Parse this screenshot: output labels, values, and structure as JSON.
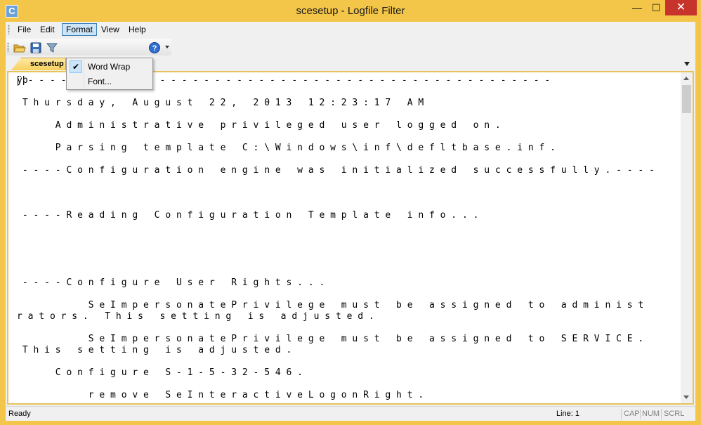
{
  "window": {
    "title": "scesetup - Logfile Filter",
    "icon_glyph": "C",
    "minimize_glyph": "—",
    "maximize_glyph": "☐",
    "close_glyph": "✕"
  },
  "menu": {
    "items": [
      "File",
      "Edit",
      "Format",
      "View",
      "Help"
    ],
    "active": "Format"
  },
  "format_menu": {
    "items": [
      {
        "label": "Word Wrap",
        "checked": true,
        "check_glyph": "✔"
      },
      {
        "label": "Font...",
        "checked": false
      }
    ]
  },
  "toolbar": {
    "buttons": [
      "open-folder-icon",
      "save-icon",
      "filter-icon",
      "help-icon"
    ]
  },
  "tab": {
    "label": "scesetup"
  },
  "log_lines": [
    "ÿþ- - - - - - - - - - - - - - - - - - - - - - - - - - - - - - - - - - - - - - - - - - - - - - - -",
    "",
    " T h u r s d a y ,   A u g u s t   2 2 ,   2 0 1 3   1 2 : 2 3 : 1 7   A M",
    "",
    "       A d m i n i s t r a t i v e   p r i v i l e g e d   u s e r   l o g g e d   o n .",
    "",
    "       P a r s i n g   t e m p l a t e   C : \\ W i n d o w s \\ i n f \\ d e f l t b a s e . i n f .",
    "",
    " - - - - C o n f i g u r a t i o n   e n g i n e   w a s   i n i t i a l i z e d   s u c c e s s f u l l y . - - - -",
    "",
    "",
    "",
    " - - - - R e a d i n g   C o n f i g u r a t i o n   T e m p l a t e   i n f o . . .",
    "",
    "",
    "",
    "",
    "",
    " - - - - C o n f i g u r e   U s e r   R i g h t s . . .",
    "",
    "             S e I m p e r s o n a t e P r i v i l e g e   m u s t   b e   a s s i g n e d   t o   a d m i n i s t",
    "r a t o r s .   T h i s   s e t t i n g   i s   a d j u s t e d .",
    "",
    "             S e I m p e r s o n a t e P r i v i l e g e   m u s t   b e   a s s i g n e d   t o   S E R V I C E .",
    " T h i s   s e t t i n g   i s   a d j u s t e d .",
    "",
    "       C o n f i g u r e   S - 1 - 5 - 3 2 - 5 4 6 .",
    "",
    "             r e m o v e   S e I n t e r a c t i v e L o g o n R i g h t ."
  ],
  "status": {
    "text": "Ready",
    "line": "Line: 1",
    "cap": "CAP",
    "num": "NUM",
    "scrl": "SCRL"
  },
  "colors": {
    "frame": "#f3c548",
    "close_button": "#c7342c",
    "menu_highlight": "#cce4f7"
  }
}
